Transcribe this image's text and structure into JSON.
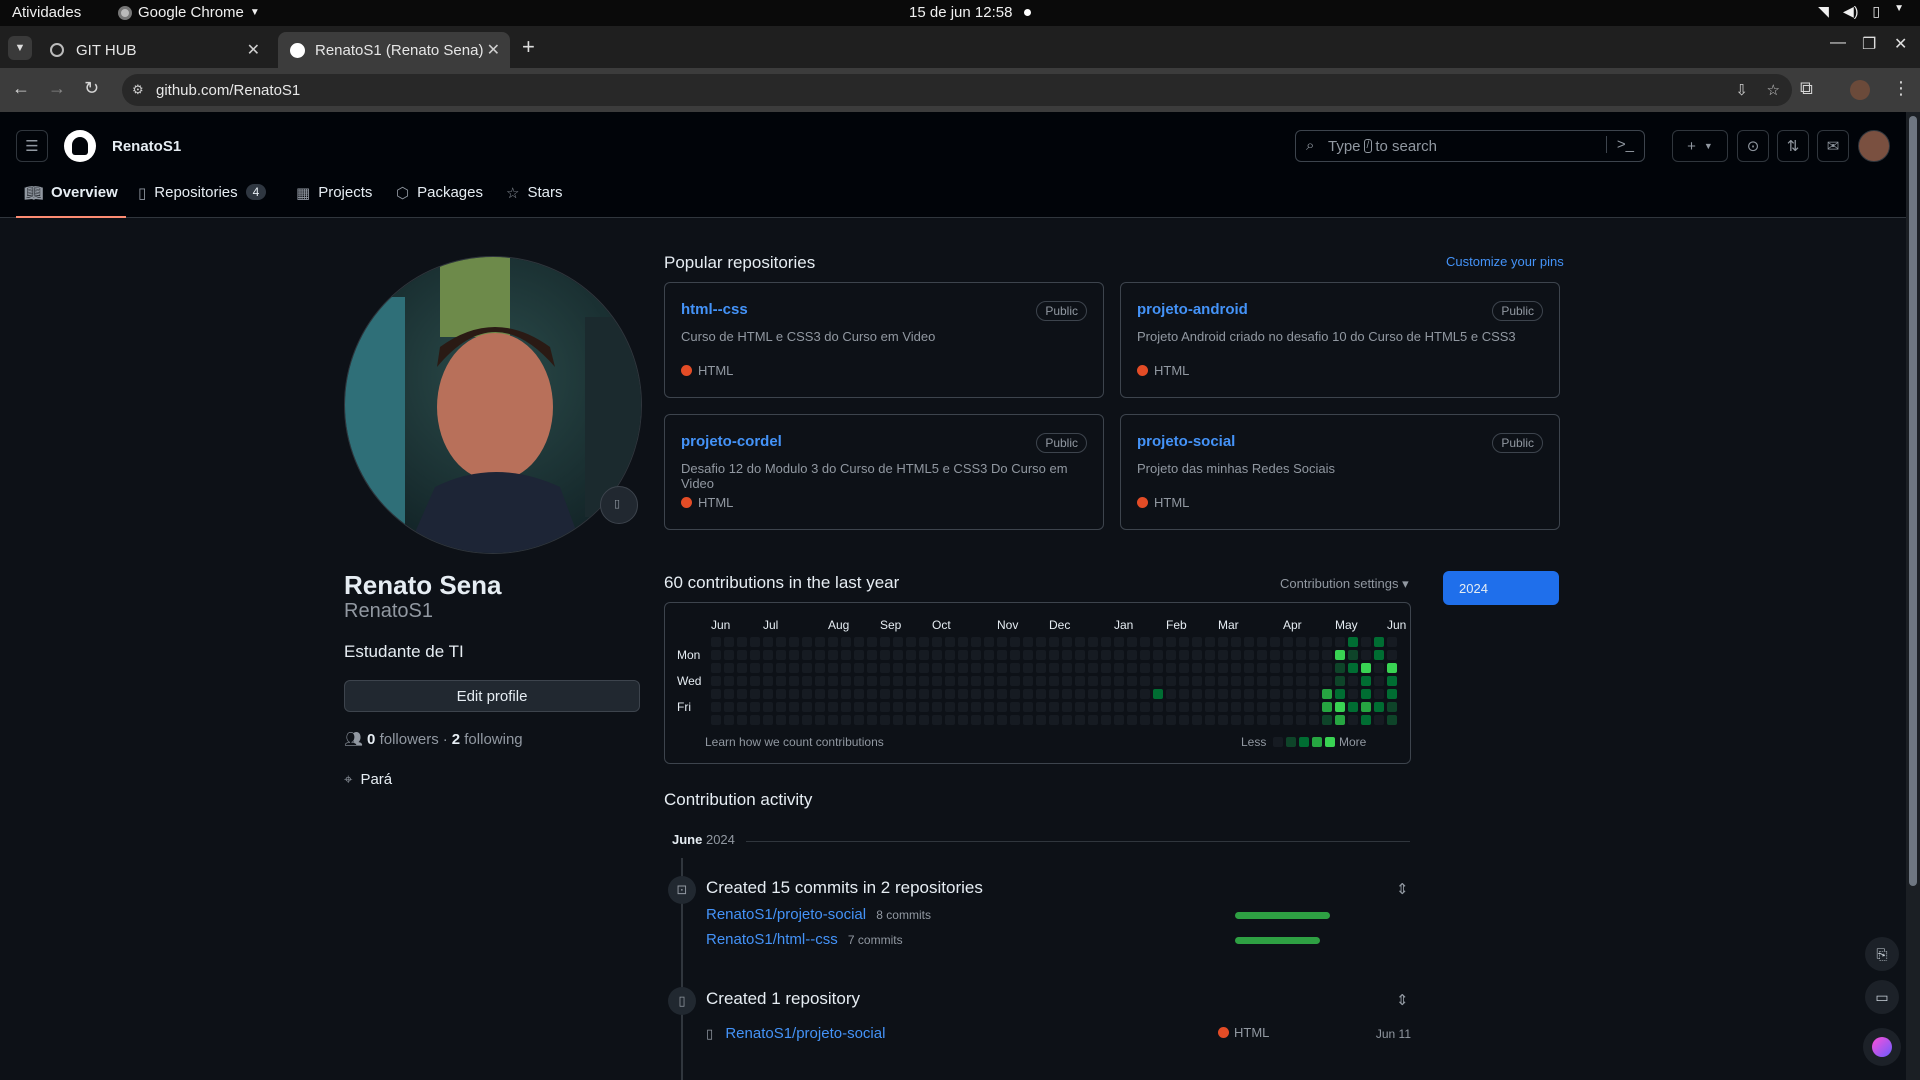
{
  "system": {
    "activities": "Atividades",
    "app": "Google Chrome",
    "clock": "15 de jun  12:58"
  },
  "browser": {
    "tabs": [
      {
        "label": "GIT HUB"
      },
      {
        "label": "RenatoS1 (Renato Sena)"
      }
    ],
    "new_tab": "+",
    "url": "github.com/RenatoS1"
  },
  "github": {
    "username": "RenatoS1",
    "search_placeholder": "Type / to search",
    "search_before": "Type",
    "search_key": "/",
    "search_after": "to search",
    "nav": [
      {
        "label": "Overview"
      },
      {
        "label": "Repositories",
        "count": "4"
      },
      {
        "label": "Projects"
      },
      {
        "label": "Packages"
      },
      {
        "label": "Stars"
      }
    ]
  },
  "profile": {
    "fullname": "Renato Sena",
    "login": "RenatoS1",
    "bio": "Estudante de TI",
    "edit_button": "Edit profile",
    "followers_count": "0",
    "followers_label": "followers",
    "separator": "·",
    "following_count": "2",
    "following_label": "following",
    "location": "Pará"
  },
  "popular": {
    "title": "Popular repositories",
    "customize": "Customize your pins",
    "repos": [
      {
        "name": "html--css",
        "badge": "Public",
        "desc": "Curso de HTML e CSS3 do Curso em Video",
        "lang": "HTML"
      },
      {
        "name": "projeto-android",
        "badge": "Public",
        "desc": "Projeto Android criado no desafio 10 do Curso de HTML5 e CSS3",
        "lang": "HTML"
      },
      {
        "name": "projeto-cordel",
        "badge": "Public",
        "desc": "Desafio 12 do Modulo 3 do Curso de HTML5 e CSS3 Do Curso em Video",
        "lang": "HTML"
      },
      {
        "name": "projeto-social",
        "badge": "Public",
        "desc": "Projeto das minhas Redes Sociais",
        "lang": "HTML"
      }
    ]
  },
  "contributions": {
    "title": "60 contributions in the last year",
    "settings": "Contribution settings ▾",
    "year": "2024",
    "months": [
      "Jun",
      "Jul",
      "Aug",
      "Sep",
      "Oct",
      "Nov",
      "Dec",
      "Jan",
      "Feb",
      "Mar",
      "Apr",
      "May",
      "Jun"
    ],
    "days": [
      "Mon",
      "Wed",
      "Fri"
    ],
    "learn": "Learn how we count contributions",
    "less": "Less",
    "more": "More",
    "colors": [
      "#161b22",
      "#0e4429",
      "#006d32",
      "#26a641",
      "#39d353"
    ]
  },
  "activity": {
    "title": "Contribution activity",
    "month": "June",
    "year": "2024",
    "commits_title": "Created 15 commits in 2 repositories",
    "commit_repos": [
      {
        "name": "RenatoS1/projeto-social",
        "count": "8 commits",
        "share": 0.53
      },
      {
        "name": "RenatoS1/html--css",
        "count": "7 commits",
        "share": 0.47
      }
    ],
    "repo_title": "Created 1 repository",
    "created_repo": {
      "name": "RenatoS1/projeto-social",
      "lang": "HTML",
      "date": "Jun 11"
    }
  }
}
